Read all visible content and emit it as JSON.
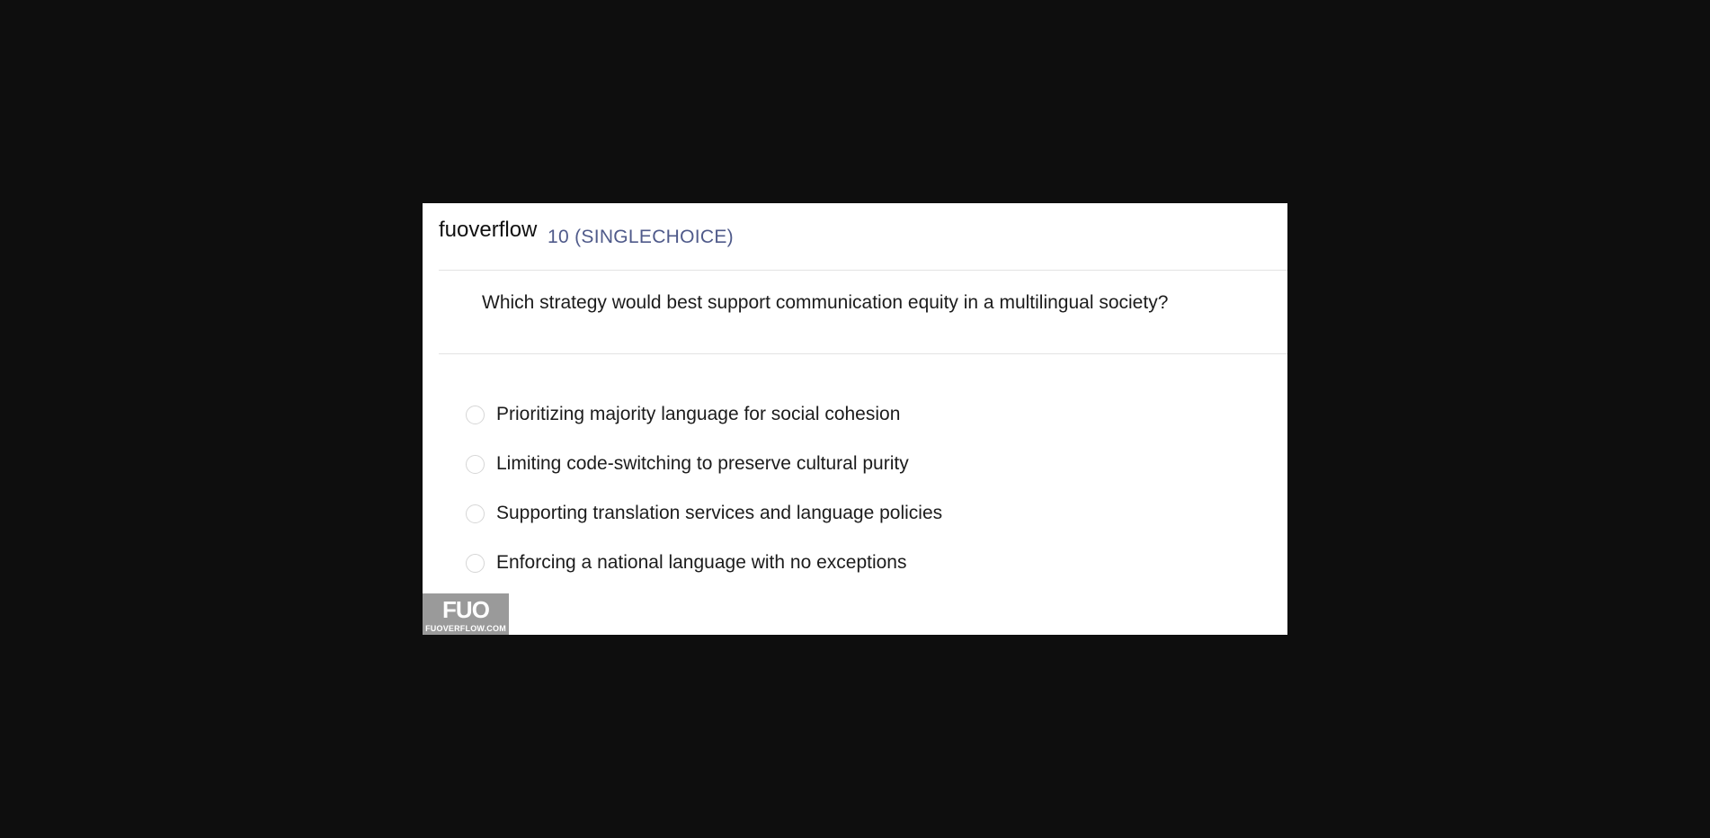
{
  "header": {
    "site_name": "fuoverflow",
    "question_meta": "10 (SINGLECHOICE)"
  },
  "question": {
    "text": "Which strategy would best support communication equity in a multilingual society?"
  },
  "options": [
    {
      "label": "Prioritizing majority language for social cohesion",
      "selected": false
    },
    {
      "label": "Limiting code-switching to preserve cultural purity",
      "selected": false
    },
    {
      "label": "Supporting translation services and language policies",
      "selected": false
    },
    {
      "label": "Enforcing a national language with no exceptions",
      "selected": false
    }
  ],
  "watermark": {
    "logo_text": "FUO",
    "url_text": "FUOVERFLOW.COM"
  },
  "colors": {
    "page_background": "#0e0e0e",
    "card_background": "#ffffff",
    "meta_text": "#4f5a8a",
    "watermark_background": "#9a9a9a"
  }
}
